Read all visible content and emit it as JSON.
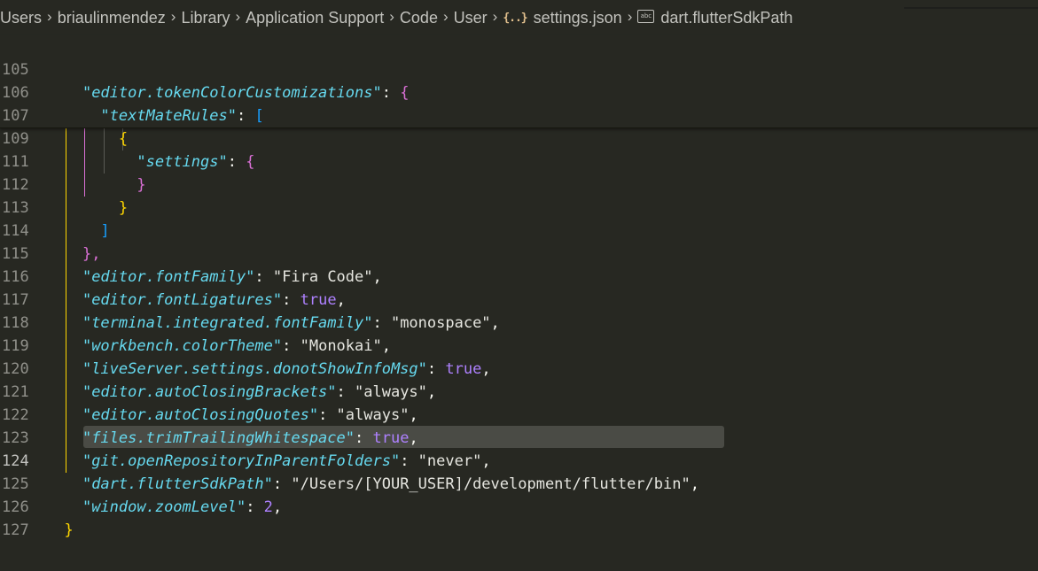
{
  "breadcrumb": {
    "items": [
      "Users",
      "briaulinmendez",
      "Library",
      "Application Support",
      "Code",
      "User",
      "settings.json",
      "dart.flutterSdkPath"
    ],
    "json_icon": "{..}",
    "abc_icon": "abc",
    "separator": ">"
  },
  "editor": {
    "active_line": 124,
    "theme_colors": {
      "background": "#272822",
      "key": "#66d9ef",
      "string": "#e6db74",
      "number": "#ae81ff",
      "bracket_gold": "#ffd700",
      "bracket_orchid": "#da70d6",
      "bracket_blue": "#179fff"
    },
    "sticky_lines": [
      {
        "n": "105",
        "indent": "    ",
        "key": "\"editor.tokenColorCustomizations\"",
        "colon": ": ",
        "open": "{"
      },
      {
        "n": "106",
        "indent": "      ",
        "key": "\"textMateRules\"",
        "colon": ": ",
        "open": "["
      },
      {
        "n": "107",
        "indent": "        ",
        "open": "{"
      },
      {
        "n": "109",
        "indent": "          ",
        "key": "\"settings\"",
        "colon": ": ",
        "open": "{"
      }
    ],
    "lines": [
      {
        "n": "111",
        "indent": "          ",
        "close": "}"
      },
      {
        "n": "112",
        "indent": "        ",
        "close": "}"
      },
      {
        "n": "113",
        "indent": "      ",
        "close": "]"
      },
      {
        "n": "114",
        "indent": "    ",
        "close": "},"
      },
      {
        "n": "115",
        "key": "\"editor.fontFamily\"",
        "value": "\"Fira Code\"",
        "tail": ","
      },
      {
        "n": "116",
        "key": "\"editor.fontLigatures\"",
        "value": "true",
        "tail": ","
      },
      {
        "n": "117",
        "key": "\"terminal.integrated.fontFamily\"",
        "value": "\"monospace\"",
        "tail": ","
      },
      {
        "n": "118",
        "key": "\"workbench.colorTheme\"",
        "value": "\"Monokai\"",
        "tail": ","
      },
      {
        "n": "119",
        "key": "\"liveServer.settings.donotShowInfoMsg\"",
        "value": "true",
        "tail": ","
      },
      {
        "n": "120",
        "key": "\"editor.autoClosingBrackets\"",
        "value": "\"always\"",
        "tail": ","
      },
      {
        "n": "121",
        "key": "\"editor.autoClosingQuotes\"",
        "value": "\"always\"",
        "tail": ","
      },
      {
        "n": "122",
        "key": "\"files.trimTrailingWhitespace\"",
        "value": "true",
        "tail": ","
      },
      {
        "n": "123",
        "key": "\"git.openRepositoryInParentFolders\"",
        "value": "\"never\"",
        "tail": ","
      },
      {
        "n": "124",
        "key": "\"dart.flutterSdkPath\"",
        "value": "\"/Users/[YOUR_USER]/development/flutter/bin\"",
        "tail": ","
      },
      {
        "n": "125",
        "key": "\"window.zoomLevel\"",
        "value": "2",
        "tail": ","
      },
      {
        "n": "126",
        "close": "}"
      },
      {
        "n": "127"
      }
    ]
  }
}
